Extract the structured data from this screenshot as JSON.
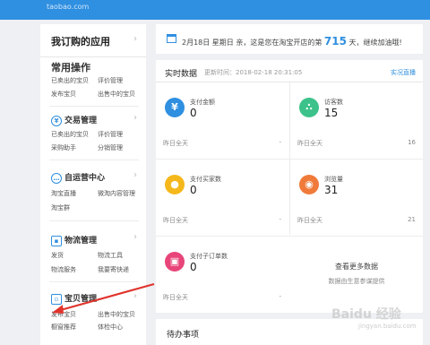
{
  "topbar": {
    "site": "taobao.com"
  },
  "sidebar": {
    "header": "我订购的应用",
    "common": {
      "title": "常用操作",
      "links": [
        "已卖出的宝贝",
        "评价管理",
        "发布宝贝",
        "出售中的宝贝"
      ]
    },
    "trade": {
      "title": "交易管理",
      "links": [
        "已卖出的宝贝",
        "评价管理",
        "采购助手",
        "分销管理"
      ]
    },
    "ops": {
      "title": "自运营中心",
      "links": [
        "淘宝直播",
        "微淘内容管理",
        "淘宝群"
      ]
    },
    "logistics": {
      "title": "物流管理",
      "links": [
        "发货",
        "物流工具",
        "物流服务",
        "我要寄快递"
      ]
    },
    "goods": {
      "title": "宝贝管理",
      "links": [
        "发布宝贝",
        "出售中的宝贝",
        "橱窗推荐",
        "体检中心"
      ]
    }
  },
  "notice": {
    "date": "2月18日 星期日",
    "text_before": "亲，这是您在淘宝开店的第",
    "days": "715",
    "text_after": "天，继续加油哦!"
  },
  "realtime": {
    "title": "实时数据",
    "updated": "更新时间：2018-02-18 20:31:05",
    "link": "实况直播",
    "metrics": [
      {
        "label": "支付金额",
        "value": "0",
        "yesterday_label": "昨日全天",
        "yesterday_value": "-",
        "icon": "yen-icon",
        "color": "#2f8fe0"
      },
      {
        "label": "访客数",
        "value": "15",
        "yesterday_label": "昨日全天",
        "yesterday_value": "16",
        "icon": "footprint-icon",
        "color": "#3cc28a"
      },
      {
        "label": "支付买家数",
        "value": "0",
        "yesterday_label": "昨日全天",
        "yesterday_value": "-",
        "icon": "buyers-icon",
        "color": "#f5b81c"
      },
      {
        "label": "浏览量",
        "value": "31",
        "yesterday_label": "昨日全天",
        "yesterday_value": "21",
        "icon": "eye-icon",
        "color": "#f07a3a"
      },
      {
        "label": "支付子订单数",
        "value": "0",
        "yesterday_label": "昨日全天",
        "yesterday_value": "-",
        "icon": "order-icon",
        "color": "#e8457a"
      }
    ],
    "more": {
      "title": "查看更多数据",
      "subtitle": "数据由生意参谋提供"
    }
  },
  "todo": {
    "title": "待办事项"
  },
  "watermark": {
    "main": "Baidu 经验",
    "sub": "jingyan.baidu.com"
  }
}
